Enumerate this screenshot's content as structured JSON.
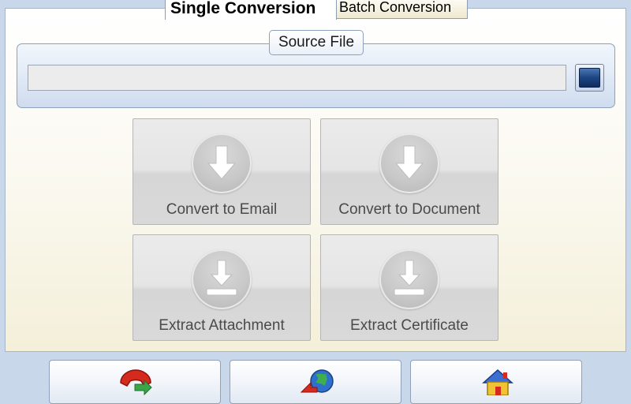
{
  "tabs": {
    "single": "Single Conversion",
    "batch": "Batch Conversion"
  },
  "source": {
    "legend": "Source File",
    "path_value": ""
  },
  "actions": {
    "convert_email": "Convert to Email",
    "convert_document": "Convert to Document",
    "extract_attachment": "Extract Attachment",
    "extract_certificate": "Extract Certificate"
  },
  "icons": {
    "browse": "browse-folder-icon",
    "convert": "download-arrow-icon",
    "extract": "download-tray-icon",
    "support": "phone-icon",
    "web": "globe-icon",
    "home": "home-icon"
  },
  "colors": {
    "accent": "#1d4581",
    "panel": "#faf8ee",
    "tile": "#e2e2e2"
  }
}
